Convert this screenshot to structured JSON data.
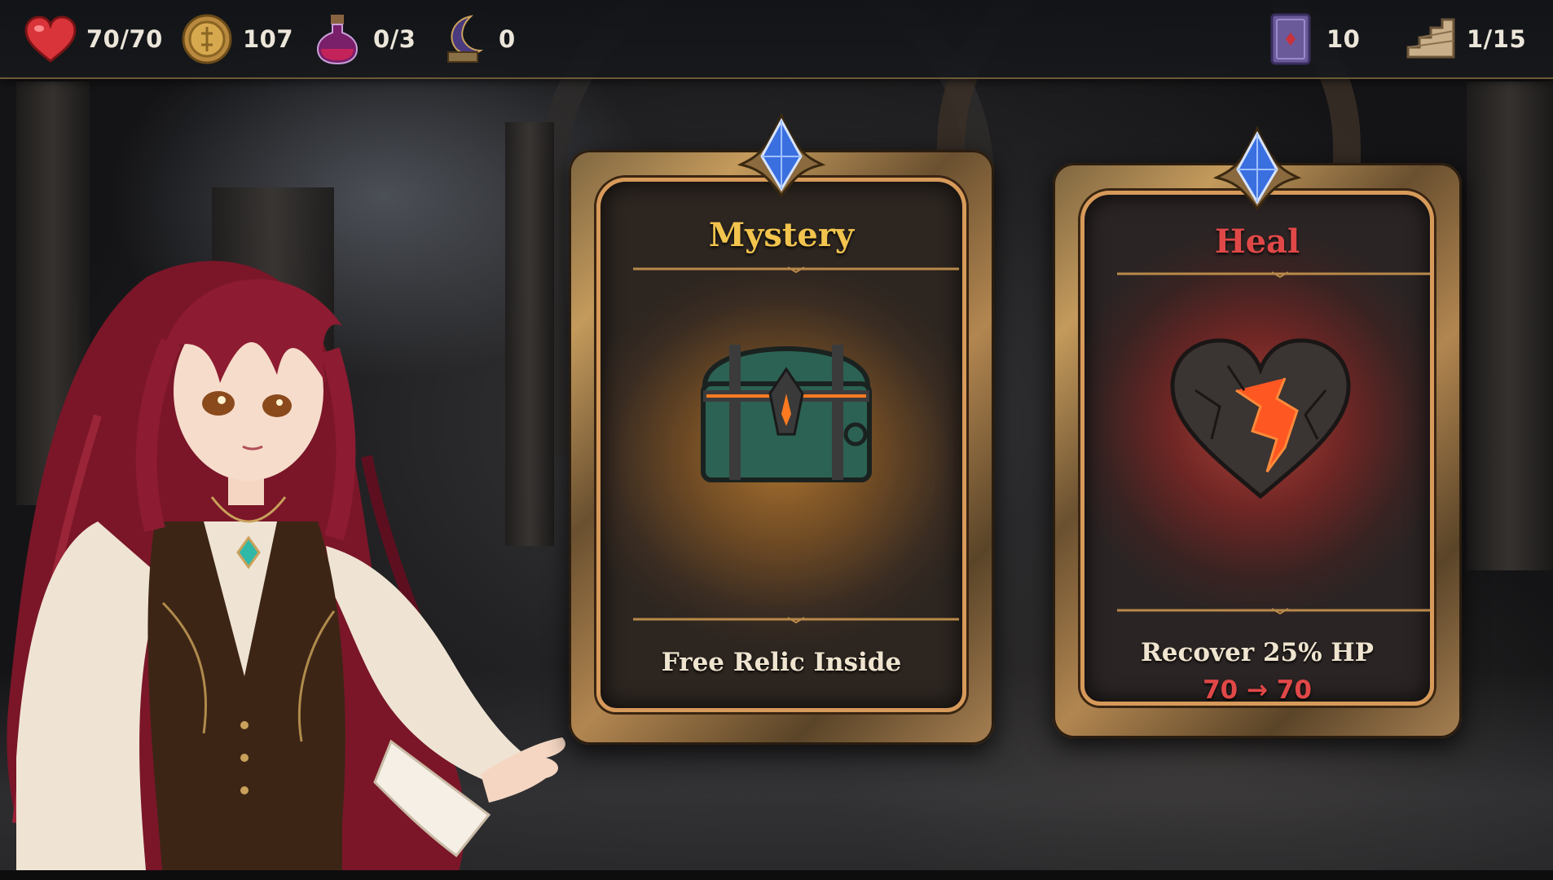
{
  "hud": {
    "hp": "70/70",
    "gold": "107",
    "potions": "0/3",
    "relic_count": "0",
    "deck_count": "10",
    "floor": "1/15"
  },
  "cards": [
    {
      "title": "Mystery",
      "title_color": "#f2c44e",
      "description": "Free Relic Inside",
      "detail": "",
      "icon": "treasure-chest-icon"
    },
    {
      "title": "Heal",
      "title_color": "#e04848",
      "description": "Recover 25% HP",
      "detail": "70 → 70",
      "detail_color": "#e04848",
      "icon": "cracked-heart-icon"
    }
  ],
  "colors": {
    "frame_gold": "#b28650",
    "gem_blue": "#3a6fe0",
    "hud_bg": "#16181c"
  }
}
